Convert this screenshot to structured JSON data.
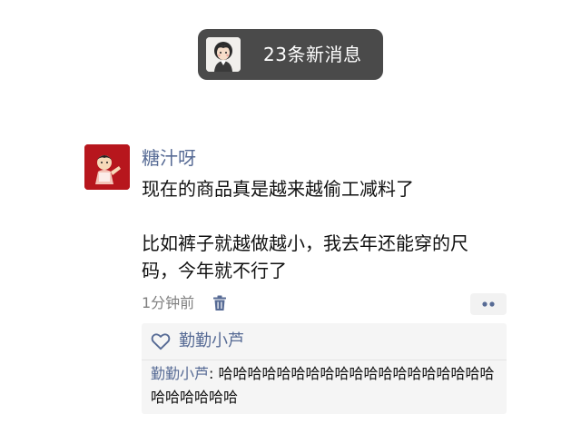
{
  "new_messages": {
    "label": "23条新消息"
  },
  "post": {
    "author": "糖汁呀",
    "content_line_1": "现在的商品真是越来越偷工减料了",
    "content_line_2": "比如裤子就越做越小，我去年还能穿的尺",
    "content_line_3": "码，今年就不行了",
    "time": "1分钟前"
  },
  "likes": {
    "names": "勤勤小芦"
  },
  "comments": [
    {
      "author": "勤勤小芦",
      "separator": ": ",
      "text": "哈哈哈哈哈哈哈哈哈哈哈哈哈哈哈哈哈哈哈哈哈哈哈哈哈"
    }
  ],
  "colors": {
    "link_blue": "#576b95",
    "pill_bg": "#4a4a4a",
    "panel_bg": "#f5f5f5"
  },
  "icons": {
    "pill_avatar": "cartoon-girl-avatar",
    "post_avatar": "red-character-avatar",
    "delete": "trash-icon",
    "more": "more-dots-icon",
    "like": "heart-outline-icon"
  }
}
